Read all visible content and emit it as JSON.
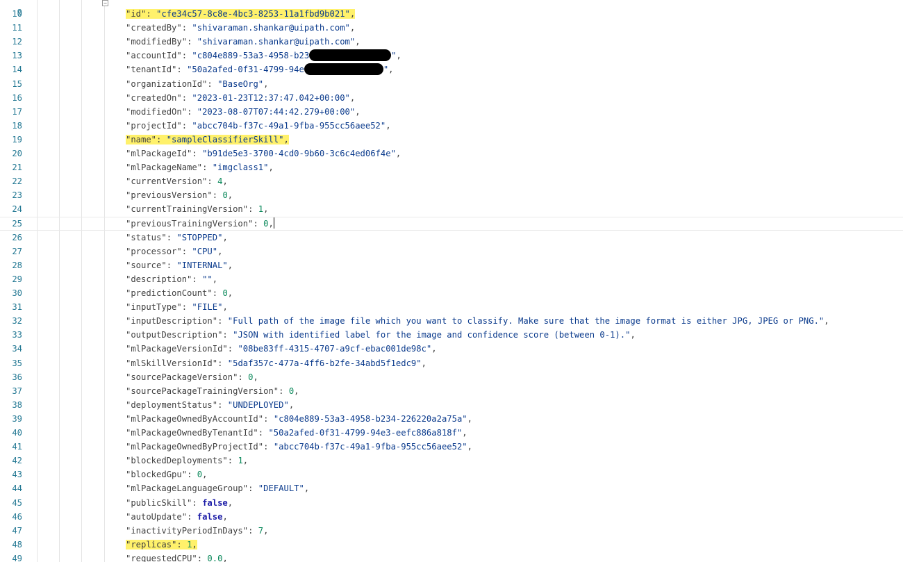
{
  "editor": {
    "current_line": 25,
    "top_partial_line": "9",
    "lines": [
      {
        "n": "10",
        "key": "id",
        "type": "str",
        "value": "cfe34c57-8c8e-4bc3-8253-11a1fbd9b021",
        "highlight": true
      },
      {
        "n": "11",
        "key": "createdBy",
        "type": "str",
        "value": "shivaraman.shankar@uipath.com"
      },
      {
        "n": "12",
        "key": "modifiedBy",
        "type": "str",
        "value": "shivaraman.shankar@uipath.com"
      },
      {
        "n": "13",
        "key": "accountId",
        "type": "str",
        "value": "c804e889-53a3-4958-b23",
        "redacted": true
      },
      {
        "n": "14",
        "key": "tenantId",
        "type": "str",
        "value": "50a2afed-0f31-4799-94e",
        "redacted": true
      },
      {
        "n": "15",
        "key": "organizationId",
        "type": "str",
        "value": "BaseOrg"
      },
      {
        "n": "16",
        "key": "createdOn",
        "type": "str",
        "value": "2023-01-23T12:37:47.042+00:00"
      },
      {
        "n": "17",
        "key": "modifiedOn",
        "type": "str",
        "value": "2023-08-07T07:44:42.279+00:00"
      },
      {
        "n": "18",
        "key": "projectId",
        "type": "str",
        "value": "abcc704b-f37c-49a1-9fba-955cc56aee52"
      },
      {
        "n": "19",
        "key": "name",
        "type": "str",
        "value": "sampleClassifierSkill",
        "highlight": true
      },
      {
        "n": "20",
        "key": "mlPackageId",
        "type": "str",
        "value": "b91de5e3-3700-4cd0-9b60-3c6c4ed06f4e"
      },
      {
        "n": "21",
        "key": "mlPackageName",
        "type": "str",
        "value": "imgclass1"
      },
      {
        "n": "22",
        "key": "currentVersion",
        "type": "num",
        "value": "4"
      },
      {
        "n": "23",
        "key": "previousVersion",
        "type": "num",
        "value": "0"
      },
      {
        "n": "24",
        "key": "currentTrainingVersion",
        "type": "num",
        "value": "1"
      },
      {
        "n": "25",
        "key": "previousTrainingVersion",
        "type": "num",
        "value": "0",
        "caret": true
      },
      {
        "n": "26",
        "key": "status",
        "type": "str",
        "value": "STOPPED"
      },
      {
        "n": "27",
        "key": "processor",
        "type": "str",
        "value": "CPU"
      },
      {
        "n": "28",
        "key": "source",
        "type": "str",
        "value": "INTERNAL"
      },
      {
        "n": "29",
        "key": "description",
        "type": "str",
        "value": ""
      },
      {
        "n": "30",
        "key": "predictionCount",
        "type": "num",
        "value": "0"
      },
      {
        "n": "31",
        "key": "inputType",
        "type": "str",
        "value": "FILE"
      },
      {
        "n": "32",
        "key": "inputDescription",
        "type": "str",
        "value": "Full path of the image file which you want to classify. Make sure that the image format is either JPG, JPEG or PNG."
      },
      {
        "n": "33",
        "key": "outputDescription",
        "type": "str",
        "value": "JSON with identified label for the image and confidence score (between 0-1)."
      },
      {
        "n": "34",
        "key": "mlPackageVersionId",
        "type": "str",
        "value": "08be83ff-4315-4707-a9cf-ebac001de98c"
      },
      {
        "n": "35",
        "key": "mlSkillVersionId",
        "type": "str",
        "value": "5daf357c-477a-4ff6-b2fe-34abd5f1edc9"
      },
      {
        "n": "36",
        "key": "sourcePackageVersion",
        "type": "num",
        "value": "0"
      },
      {
        "n": "37",
        "key": "sourcePackageTrainingVersion",
        "type": "num",
        "value": "0"
      },
      {
        "n": "38",
        "key": "deploymentStatus",
        "type": "str",
        "value": "UNDEPLOYED"
      },
      {
        "n": "39",
        "key": "mlPackageOwnedByAccountId",
        "type": "str",
        "value": "c804e889-53a3-4958-b234-226220a2a75a"
      },
      {
        "n": "40",
        "key": "mlPackageOwnedByTenantId",
        "type": "str",
        "value": "50a2afed-0f31-4799-94e3-eefc886a818f"
      },
      {
        "n": "41",
        "key": "mlPackageOwnedByProjectId",
        "type": "str",
        "value": "abcc704b-f37c-49a1-9fba-955cc56aee52"
      },
      {
        "n": "42",
        "key": "blockedDeployments",
        "type": "num",
        "value": "1"
      },
      {
        "n": "43",
        "key": "blockedGpu",
        "type": "num",
        "value": "0"
      },
      {
        "n": "44",
        "key": "mlPackageLanguageGroup",
        "type": "str",
        "value": "DEFAULT"
      },
      {
        "n": "45",
        "key": "publicSkill",
        "type": "bool",
        "value": "false"
      },
      {
        "n": "46",
        "key": "autoUpdate",
        "type": "bool",
        "value": "false"
      },
      {
        "n": "47",
        "key": "inactivityPeriodInDays",
        "type": "num",
        "value": "7"
      },
      {
        "n": "48",
        "key": "replicas",
        "type": "num",
        "value": "1",
        "highlight": true
      },
      {
        "n": "49",
        "key": "requestedCPU",
        "type": "num",
        "value": "0.0"
      }
    ]
  }
}
